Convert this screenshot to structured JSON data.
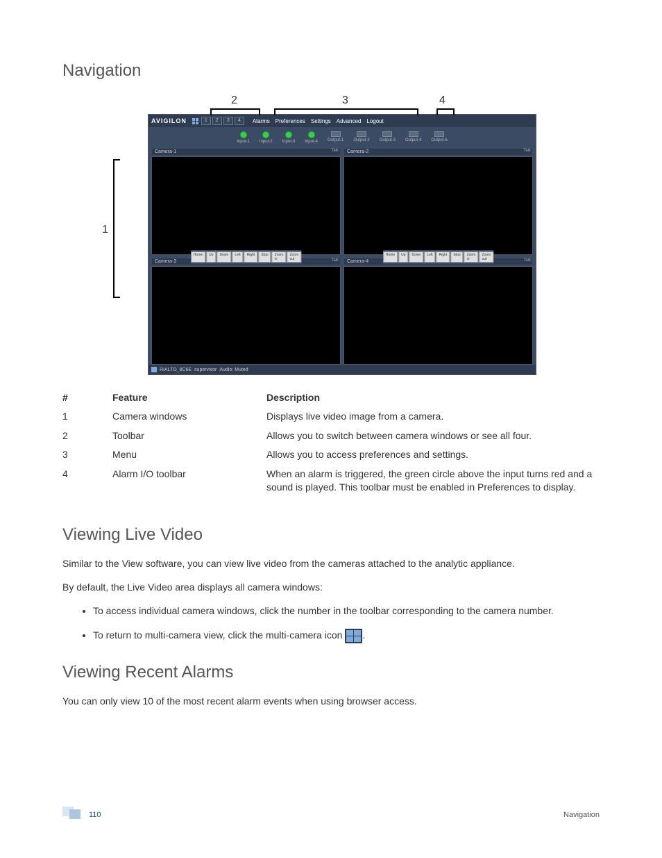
{
  "sections": {
    "navigation": "Navigation",
    "viewing_live": "Viewing Live Video",
    "viewing_alarms": "Viewing Recent Alarms"
  },
  "callouts": {
    "c1": "1",
    "c2": "2",
    "c3": "3",
    "c4": "4"
  },
  "app": {
    "logo": "AVIGILON",
    "tb_nums": [
      "1",
      "2",
      "3",
      "4"
    ],
    "menu": {
      "alarms": "Alarms",
      "prefs": "Preferences",
      "settings": "Settings",
      "advanced": "Advanced",
      "logout": "Logout"
    },
    "inputs": [
      "Input-1",
      "Input-2",
      "Input-3",
      "Input-4"
    ],
    "outputs": [
      "Output-1",
      "Output-2",
      "Output-3",
      "Output-4",
      "Output-5"
    ],
    "cams": {
      "c1": "Camera-1",
      "c2": "Camera-2",
      "c3": "Camera-3",
      "c4": "Camera-4",
      "talk": "Talk"
    },
    "ptz": {
      "home": "Home",
      "up": "Up",
      "down": "Down",
      "left": "Left",
      "right": "Right",
      "stop": "Stop",
      "zin": "Zoom in",
      "zout": "Zoom out"
    },
    "status": {
      "device": "RIALTO_8C6E",
      "role": "supervisor",
      "audio": "Audio: Muted"
    }
  },
  "table": {
    "headers": {
      "num": "#",
      "feature": "Feature",
      "desc": "Description"
    },
    "rows": [
      {
        "n": "1",
        "f": "Camera windows",
        "d": "Displays live video image from a camera."
      },
      {
        "n": "2",
        "f": "Toolbar",
        "d": "Allows you to switch between camera windows or see all four."
      },
      {
        "n": "3",
        "f": "Menu",
        "d": "Allows you to access preferences and settings."
      },
      {
        "n": "4",
        "f": "Alarm I/O toolbar",
        "d": "When an alarm is triggered, the green circle above the input turns red and a sound is played. This toolbar must be enabled in Preferences to display."
      }
    ]
  },
  "live_para1": "Similar to the View software, you can view live video from the cameras attached to the analytic appliance.",
  "live_para2": "By default, the Live Video area displays all camera windows:",
  "live_bullet1": "To access individual camera windows, click the number in the toolbar corresponding to the camera number.",
  "live_bullet2a": "To return to multi-camera view, click the multi-camera icon ",
  "live_bullet2b": ".",
  "alarms_para": "You can only view 10 of the most recent alarm events when using browser access.",
  "footer": {
    "page": "110",
    "section": "Navigation"
  }
}
